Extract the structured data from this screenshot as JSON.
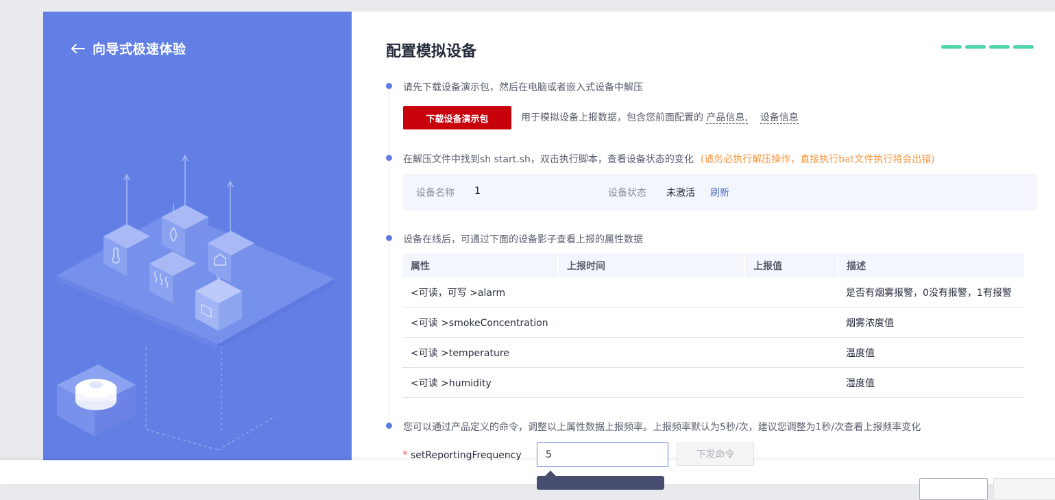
{
  "nav": {
    "back_title": "向导式极速体验"
  },
  "page": {
    "title": "配置模拟设备"
  },
  "steps": {
    "s1": {
      "text": "请先下载设备演示包，然后在电脑或者嵌入式设备中解压",
      "button_label": "下载设备演示包",
      "desc_prefix": "用于模拟设备上报数据，包含您前面配置的",
      "link_product": "产品信息,",
      "link_device": "设备信息"
    },
    "s2": {
      "text": "在解压文件中找到sh start.sh，双击执行脚本，查看设备状态的变化",
      "warning": "(请务必执行解压操作，直接执行bat文件执行将会出错)",
      "device_name_label": "设备名称",
      "device_name_value": "1",
      "device_status_label": "设备状态",
      "device_status_value": "未激活",
      "refresh_label": "刷新"
    },
    "s3": {
      "text": "设备在线后，可通过下面的设备影子查看上报的属性数据",
      "columns": [
        "属性",
        "上报时间",
        "上报值",
        "描述"
      ],
      "rows": [
        {
          "attr": "<可读，可写 >alarm",
          "time": "",
          "value": "",
          "desc": "是否有烟雾报警，0没有报警，1有报警"
        },
        {
          "attr": "<可读 >smokeConcentration",
          "time": "",
          "value": "",
          "desc": "烟雾浓度值"
        },
        {
          "attr": "<可读 >temperature",
          "time": "",
          "value": "",
          "desc": "温度值"
        },
        {
          "attr": "<可读 >humidity",
          "time": "",
          "value": "",
          "desc": "湿度值"
        }
      ]
    },
    "s4": {
      "text": "您可以通过产品定义的命令，调整以上属性数据上报频率。上报频率默认为5秒/次，建议您调整为1秒/次查看上报频率变化",
      "required_mark": "*",
      "field_label": "setReportingFrequency",
      "field_value": "5",
      "send_label": "下发命令"
    }
  },
  "colors": {
    "left_panel": "#617fe4",
    "primary_red": "#c7000b",
    "progress": "#50d4ab",
    "warning": "#fa9841",
    "link": "#526ecc"
  }
}
